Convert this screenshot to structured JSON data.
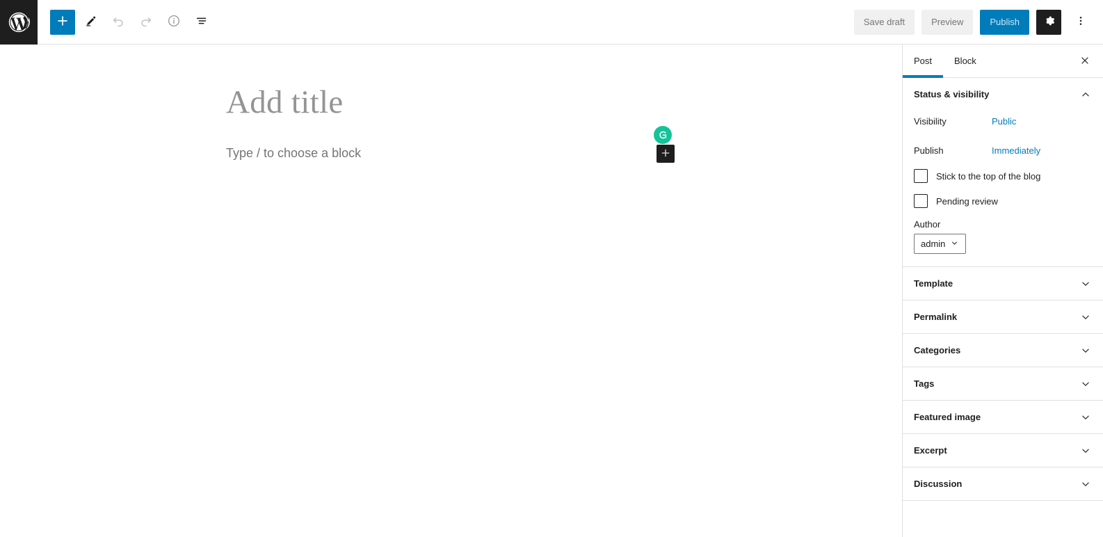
{
  "toolbar": {
    "wp_logo": "wordpress-logo",
    "left_buttons": [
      {
        "name": "add-block-button",
        "icon": "plus-icon",
        "label": "Toggle block inserter",
        "state": "primary"
      },
      {
        "name": "tools-button",
        "icon": "pencil-icon",
        "label": "Tools",
        "state": "normal"
      },
      {
        "name": "undo-button",
        "icon": "undo-icon",
        "label": "Undo",
        "state": "disabled"
      },
      {
        "name": "redo-button",
        "icon": "redo-icon",
        "label": "Redo",
        "state": "disabled"
      },
      {
        "name": "details-button",
        "icon": "info-icon",
        "label": "Details",
        "state": "normal"
      },
      {
        "name": "list-view-button",
        "icon": "list-view-icon",
        "label": "List view",
        "state": "normal"
      }
    ],
    "save_draft_label": "Save draft",
    "preview_label": "Preview",
    "publish_label": "Publish",
    "settings_label": "Settings",
    "options_label": "Options"
  },
  "editor": {
    "title_placeholder": "Add title",
    "block_placeholder": "Type / to choose a block",
    "grammarly_badge": "G",
    "inserter_label": "Add block"
  },
  "sidebar": {
    "tabs": [
      {
        "label": "Post",
        "active": true
      },
      {
        "label": "Block",
        "active": false
      }
    ],
    "close_label": "Close settings",
    "status_panel": {
      "title": "Status & visibility",
      "expanded": true,
      "visibility_label": "Visibility",
      "visibility_value": "Public",
      "publish_label": "Publish",
      "publish_value": "Immediately",
      "sticky_label": "Stick to the top of the blog",
      "sticky_checked": false,
      "pending_label": "Pending review",
      "pending_checked": false,
      "author_label": "Author",
      "author_value": "admin"
    },
    "panels": [
      {
        "title": "Template",
        "expanded": false
      },
      {
        "title": "Permalink",
        "expanded": false
      },
      {
        "title": "Categories",
        "expanded": false
      },
      {
        "title": "Tags",
        "expanded": false
      },
      {
        "title": "Featured image",
        "expanded": false
      },
      {
        "title": "Excerpt",
        "expanded": false
      },
      {
        "title": "Discussion",
        "expanded": false
      }
    ]
  },
  "colors": {
    "accent_blue": "#007cba",
    "dark": "#1e1e1e",
    "grammarly_green": "#15c39a",
    "border": "#e0e0e0",
    "muted_text": "#757575"
  }
}
